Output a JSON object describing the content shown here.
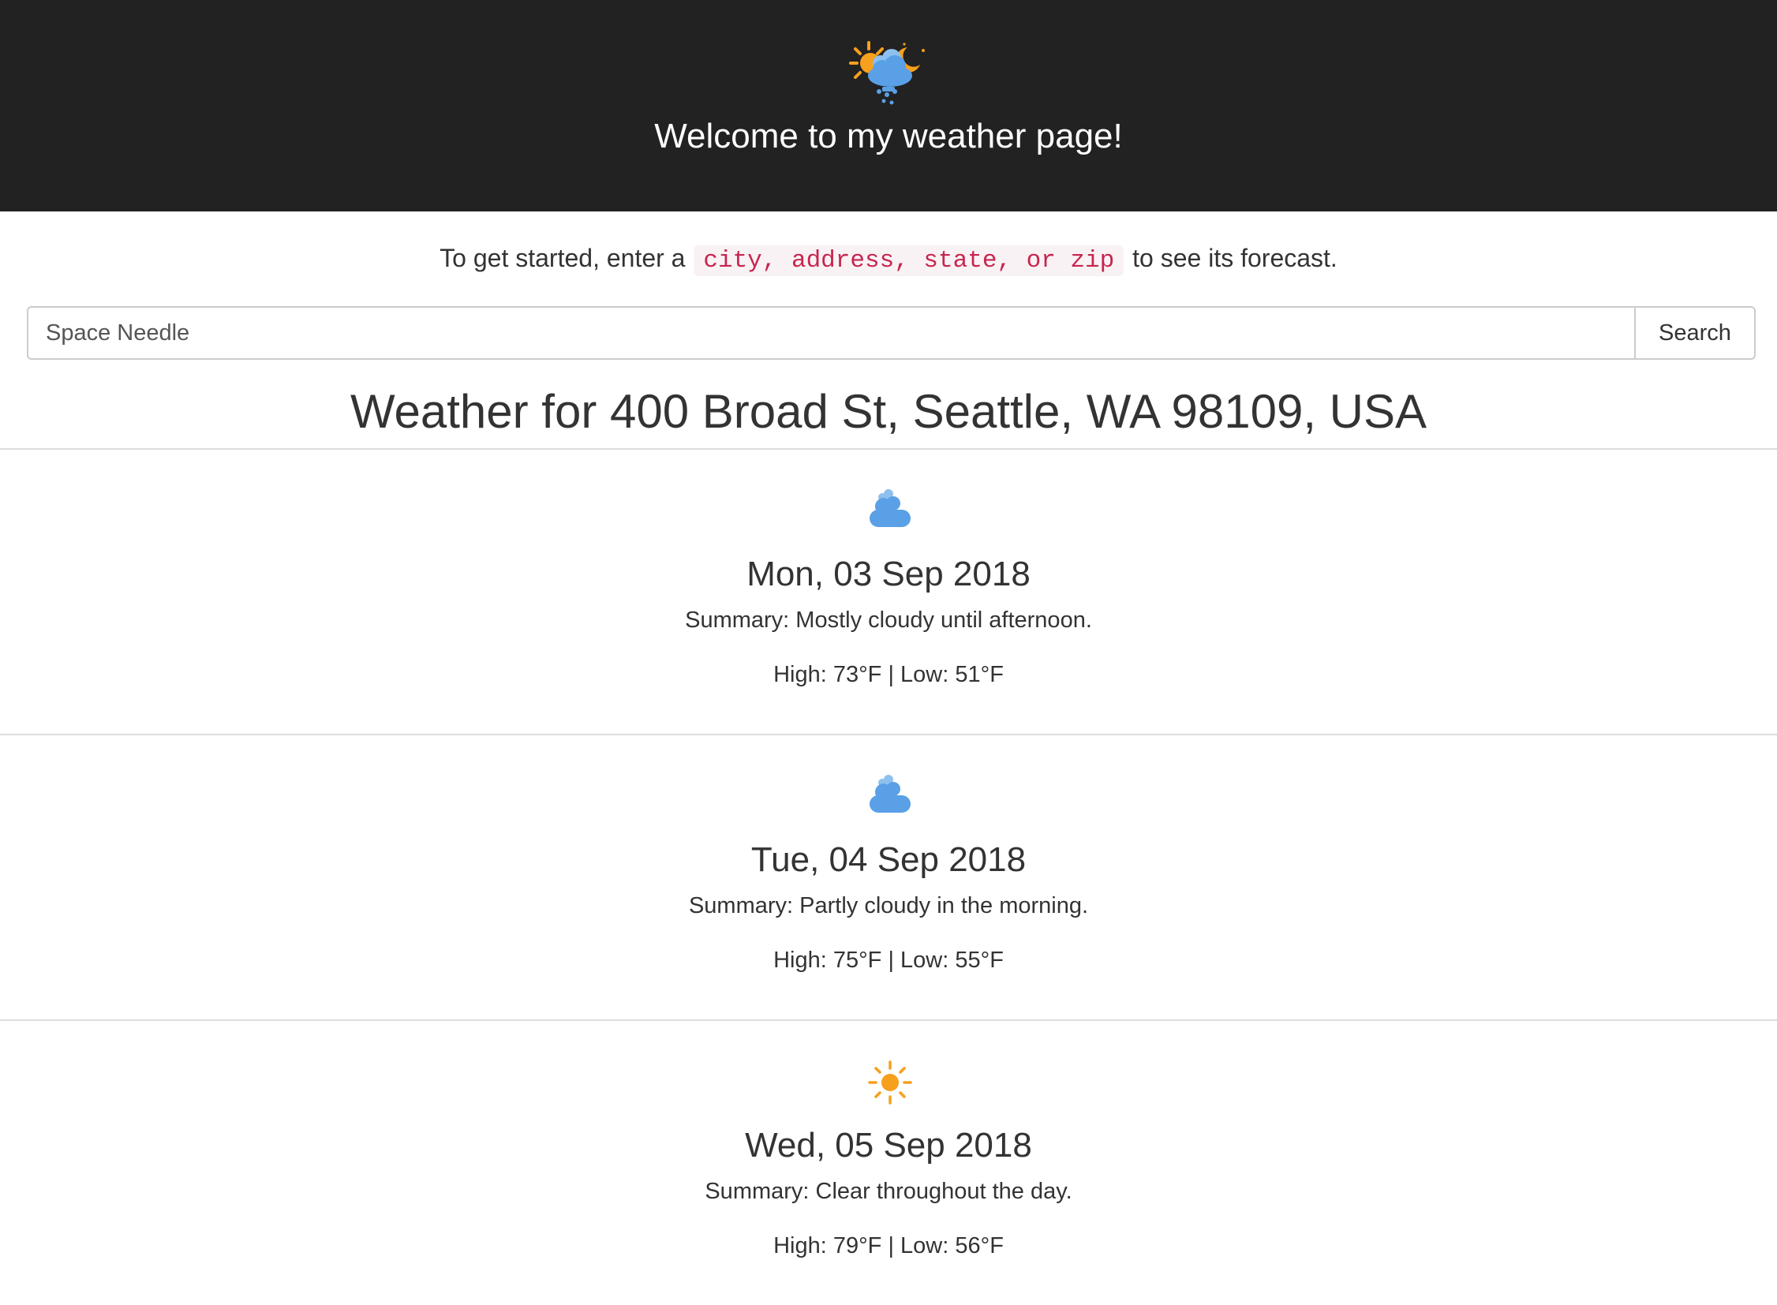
{
  "header": {
    "logo_icon": "sun-cloud-moon-rain-icon",
    "welcome": "Welcome to my weather page!",
    "background_color": "#222222"
  },
  "intro": {
    "before": "To get started, enter a",
    "code": "city, address, state, or zip",
    "after": "to see its forecast."
  },
  "search": {
    "value": "Space Needle",
    "button_label": "Search"
  },
  "location": {
    "title": "Weather for 400 Broad St, Seattle, WA 98109, USA"
  },
  "forecasts": [
    {
      "icon": "partly-cloudy-icon",
      "date": "Mon, 03 Sep 2018",
      "summary": "Summary: Mostly cloudy until afternoon.",
      "temps": "High: 73°F | Low: 51°F"
    },
    {
      "icon": "partly-cloudy-icon",
      "date": "Tue, 04 Sep 2018",
      "summary": "Summary: Partly cloudy in the morning.",
      "temps": "High: 75°F | Low: 55°F"
    },
    {
      "icon": "clear-day-icon",
      "date": "Wed, 05 Sep 2018",
      "summary": "Summary: Clear throughout the day.",
      "temps": "High: 79°F | Low: 56°F"
    }
  ],
  "colors": {
    "cloud": "#5aa0e6",
    "sun": "#f7a01d",
    "code_text": "#c7254e",
    "code_bg": "#f9f2f4"
  }
}
